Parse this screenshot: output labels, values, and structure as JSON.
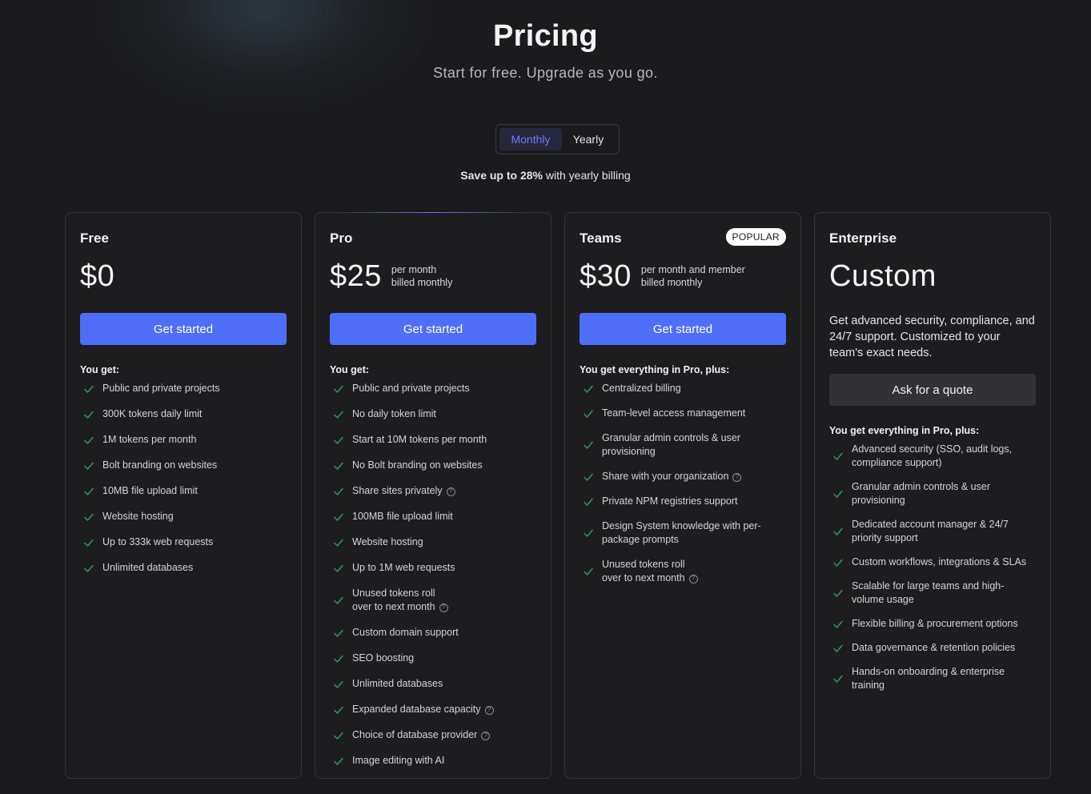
{
  "header": {
    "title": "Pricing",
    "subtitle": "Start for free. Upgrade as you go."
  },
  "billing_toggle": {
    "monthly": "Monthly",
    "yearly": "Yearly",
    "selected": "Monthly"
  },
  "save_note": {
    "prefix": "Save up to 28%",
    "suffix": "with yearly billing"
  },
  "colors": {
    "accent": "#4f6ef7",
    "check": "#2f9e55",
    "background": "#1b1b1d"
  },
  "plans": [
    {
      "name": "Free",
      "price": "$0",
      "cta": "Get started",
      "features_heading": "You get:",
      "features": [
        "Public and private projects",
        "300K tokens daily limit",
        "1M tokens per month",
        "Bolt branding on websites",
        "10MB file upload limit",
        "Website hosting",
        "Up to 333k web requests",
        "Unlimited databases"
      ]
    },
    {
      "name": "Pro",
      "price": "$25",
      "price_note_line1": "per month",
      "price_note_line2": "billed monthly",
      "cta": "Get started",
      "features_heading": "You get:",
      "features": [
        "Public and private projects",
        "No daily token limit",
        "Start at 10M tokens per month",
        "No Bolt branding on websites",
        "Share sites privately",
        "100MB file upload limit",
        "Website hosting",
        "Up to 1M web requests",
        "Unused tokens roll\nover to next month",
        "Custom domain support",
        "SEO boosting",
        "Unlimited databases",
        "Expanded database capacity",
        "Choice of database provider",
        "Image editing with AI"
      ]
    },
    {
      "name": "Teams",
      "badge": "POPULAR",
      "price": "$30",
      "price_note_line1": "per month and member",
      "price_note_line2": "billed monthly",
      "cta": "Get started",
      "features_heading": "You get everything in Pro, plus:",
      "features": [
        "Centralized billing",
        "Team-level access management",
        "Granular admin controls & user provisioning",
        "Share with your organization",
        "Private NPM registries support",
        "Design System knowledge with per-package prompts",
        "Unused tokens roll\nover to next month"
      ]
    },
    {
      "name": "Enterprise",
      "price": "Custom",
      "description": "Get advanced security, compliance, and 24/7 support. Customized to your team's exact needs.",
      "cta": "Ask for a quote",
      "features_heading": "You get everything in Pro, plus:",
      "features": [
        "Advanced security (SSO, audit logs, compliance support)",
        "Granular admin controls & user provisioning",
        "Dedicated account manager & 24/7 priority support",
        "Custom workflows, integrations & SLAs",
        "Scalable for large teams and high-volume usage",
        "Flexible billing & procurement options",
        "Data governance & retention policies",
        "Hands-on onboarding & enterprise training"
      ]
    }
  ]
}
